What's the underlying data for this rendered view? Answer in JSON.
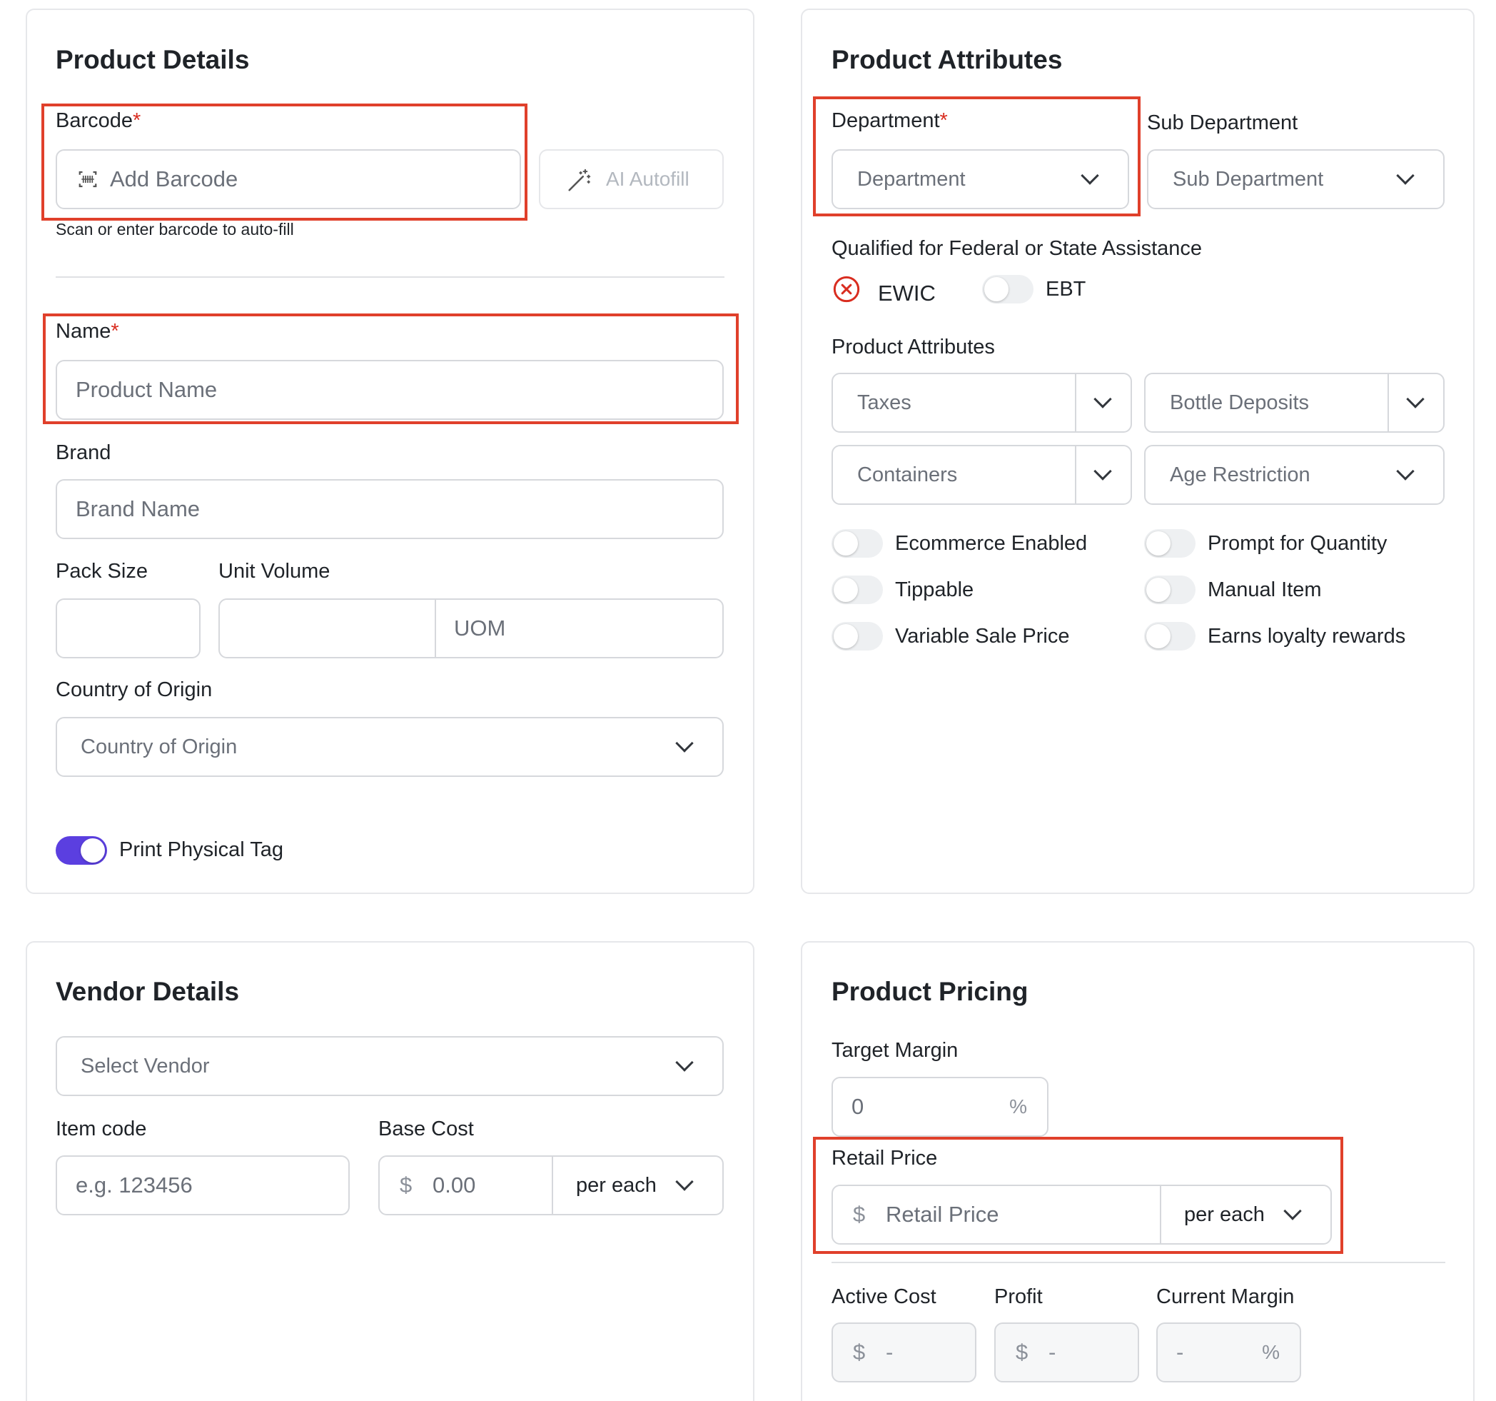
{
  "product_details": {
    "title": "Product Details",
    "barcode_label": "Barcode",
    "required_mark": "*",
    "barcode_placeholder": "Add Barcode",
    "ai_autofill_label": "AI Autofill",
    "barcode_hint": "Scan or enter barcode to auto-fill",
    "name_label": "Name",
    "name_placeholder": "Product Name",
    "brand_label": "Brand",
    "brand_placeholder": "Brand Name",
    "pack_size_label": "Pack Size",
    "unit_volume_label": "Unit Volume",
    "uom_placeholder": "UOM",
    "country_label": "Country of Origin",
    "country_placeholder": "Country of Origin",
    "print_tag_label": "Print Physical Tag",
    "print_tag_on": true
  },
  "product_attributes": {
    "title": "Product Attributes",
    "department_label": "Department",
    "department_placeholder": "Department",
    "sub_department_label": "Sub Department",
    "sub_department_placeholder": "Sub Department",
    "assistance_label": "Qualified for Federal or State Assistance",
    "ewic_label": "EWIC",
    "ebt_label": "EBT",
    "attributes_label": "Product Attributes",
    "taxes_placeholder": "Taxes",
    "bottle_deposits_placeholder": "Bottle Deposits",
    "containers_placeholder": "Containers",
    "age_restriction_placeholder": "Age Restriction",
    "toggles": {
      "ecommerce": "Ecommerce Enabled",
      "prompt_quantity": "Prompt for Quantity",
      "tippable": "Tippable",
      "manual_item": "Manual Item",
      "variable_price": "Variable Sale Price",
      "loyalty": "Earns loyalty rewards"
    }
  },
  "vendor_details": {
    "title": "Vendor Details",
    "vendor_placeholder": "Select Vendor",
    "item_code_label": "Item code",
    "item_code_placeholder": "e.g. 123456",
    "base_cost_label": "Base Cost",
    "currency_symbol": "$",
    "base_cost_placeholder": "0.00",
    "per_unit": "per each"
  },
  "product_pricing": {
    "title": "Product Pricing",
    "target_margin_label": "Target Margin",
    "target_margin_value": "0",
    "percent_symbol": "%",
    "retail_price_label": "Retail Price",
    "currency_symbol": "$",
    "retail_price_placeholder": "Retail Price",
    "per_unit": "per each",
    "active_cost_label": "Active Cost",
    "profit_label": "Profit",
    "current_margin_label": "Current Margin",
    "dash": "-"
  },
  "colors": {
    "accent": "#5b3fe0",
    "highlight": "#e0402b",
    "required": "#d92d20",
    "error_icon": "#d92d20"
  }
}
